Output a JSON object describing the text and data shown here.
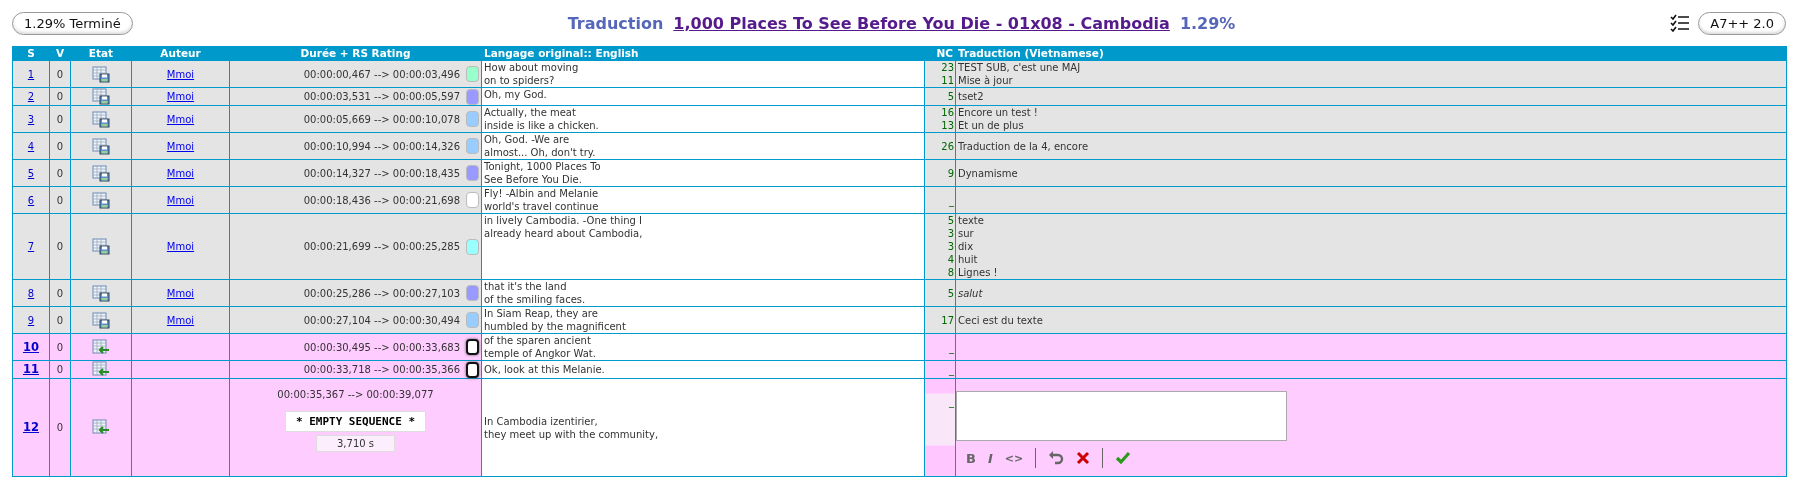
{
  "progress_button": "1.29% Terminé",
  "title": {
    "label": "Traduction",
    "link": "1,000 Places To See Before You Die - 01x08 - Cambodia",
    "percent": "1.29%"
  },
  "version_button": "A7++ 2.0",
  "table": {
    "columns": [
      "S",
      "V",
      "Etat",
      "Auteur",
      "Durée + RS Rating",
      "Langage original:: English",
      "NC",
      "Traduction (Vietnamese)"
    ],
    "rows": [
      {
        "n": "1",
        "v": "0",
        "translated": true,
        "author": "Mmoi",
        "time": "00:00:00,467 --> 00:00:03,496",
        "color": "#99ffcc",
        "original": [
          "How about moving",
          "on to spiders?"
        ],
        "translation": [
          {
            "nc": "23",
            "text": "TEST SUB, c'est une MAJ"
          },
          {
            "nc": "11",
            "text": "Mise à jour"
          }
        ]
      },
      {
        "n": "2",
        "v": "0",
        "translated": true,
        "author": "Mmoi",
        "time": "00:00:03,531 --> 00:00:05,597",
        "color": "#9999ff",
        "original": [
          "Oh, my God."
        ],
        "translation": [
          {
            "nc": "5",
            "text": "tset2"
          }
        ]
      },
      {
        "n": "3",
        "v": "0",
        "translated": true,
        "author": "Mmoi",
        "time": "00:00:05,669 --> 00:00:10,078",
        "color": "#99ccff",
        "original": [
          "Actually, the meat",
          "inside is like a chicken."
        ],
        "translation": [
          {
            "nc": "16",
            "text": "Encore un test !"
          },
          {
            "nc": "13",
            "text": "Et un de plus"
          }
        ]
      },
      {
        "n": "4",
        "v": "0",
        "translated": true,
        "author": "Mmoi",
        "time": "00:00:10,994 --> 00:00:14,326",
        "color": "#99ccff",
        "original": [
          "Oh, God. -We are",
          "almost... Oh, don't try."
        ],
        "translation": [
          {
            "nc": "26",
            "text": "Traduction de la 4, encore"
          }
        ]
      },
      {
        "n": "5",
        "v": "0",
        "translated": true,
        "author": "Mmoi",
        "time": "00:00:14,327 --> 00:00:18,435",
        "color": "#9999ff",
        "original": [
          "Tonight, 1000 Places To",
          "See Before You Die."
        ],
        "translation": [
          {
            "nc": "9",
            "text": "Dynamisme"
          }
        ]
      },
      {
        "n": "6",
        "v": "0",
        "translated": true,
        "author": "Mmoi",
        "time": "00:00:18,436 --> 00:00:21,698",
        "color": "#ffffff",
        "original": [
          "Fly! -Albin and Melanie",
          "world's travel continue"
        ],
        "translation": [
          {
            "nc": "_"
          }
        ]
      },
      {
        "n": "7",
        "v": "0",
        "translated": true,
        "author": "Mmoi",
        "time": "00:00:21,699 --> 00:00:25,285",
        "color": "#99ffff",
        "original": [
          "in lively Cambodia. -One thing I",
          "already heard about Cambodia,"
        ],
        "translation": [
          {
            "nc": "5",
            "text": "texte"
          },
          {
            "nc": "3",
            "text": "sur"
          },
          {
            "nc": "3",
            "text": "dix"
          },
          {
            "nc": "4",
            "text": "huit"
          },
          {
            "nc": "8",
            "text": "Lignes !"
          }
        ]
      },
      {
        "n": "8",
        "v": "0",
        "translated": true,
        "author": "Mmoi",
        "time": "00:00:25,286 --> 00:00:27,103",
        "color": "#9999ff",
        "original": [
          "that it's the land",
          "of the smiling faces."
        ],
        "translation": [
          {
            "nc": "5",
            "text": "salut",
            "italic": true
          }
        ]
      },
      {
        "n": "9",
        "v": "0",
        "translated": true,
        "author": "Mmoi",
        "time": "00:00:27,104 --> 00:00:30,494",
        "color": "#99ccff",
        "original": [
          "In Siam Reap, they are",
          "humbled by the magnificent"
        ],
        "translation": [
          {
            "nc": "17",
            "text": "Ceci est du texte"
          }
        ]
      },
      {
        "n": "10",
        "v": "0",
        "translated": false,
        "time": "00:00:30,495 --> 00:00:33,683",
        "color": "#ffffff",
        "original": [
          "of the sparen ancient",
          "temple of Angkor Wat."
        ],
        "translation": [
          {
            "nc": "_"
          }
        ]
      },
      {
        "n": "11",
        "v": "0",
        "translated": false,
        "time": "00:00:33,718 --> 00:00:35,366",
        "color": "#ffffff",
        "original": [
          "Ok, look at this Melanie."
        ],
        "translation": [
          {
            "nc": "_"
          }
        ]
      },
      {
        "n": "12",
        "v": "0",
        "translated": false,
        "editing": true,
        "time": "00:00:35,367 --> 00:00:39,077",
        "empty_label": "* EMPTY SEQUENCE *",
        "duration": "3,710 s",
        "original": [
          "In Cambodia izentirier,",
          "they meet up with the community,"
        ],
        "translation": [
          {
            "nc": "_"
          }
        ],
        "toolbar": [
          {
            "kind": "bold",
            "label": "B"
          },
          {
            "kind": "italic",
            "label": "I"
          },
          {
            "kind": "code",
            "label": "<>"
          },
          {
            "kind": "undo"
          },
          {
            "kind": "cancel"
          },
          {
            "kind": "confirm"
          }
        ]
      }
    ]
  }
}
